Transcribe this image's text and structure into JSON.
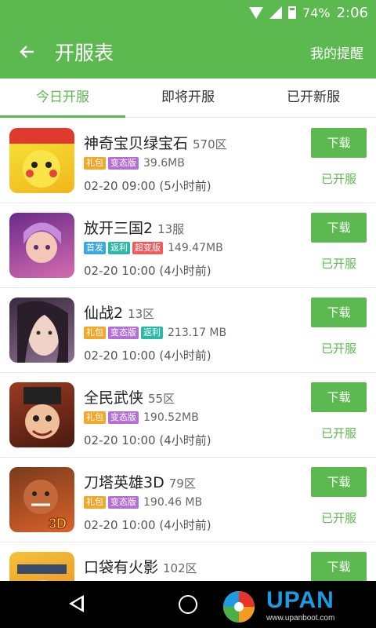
{
  "status_bar": {
    "battery": "74%",
    "time": "2:06"
  },
  "header": {
    "title": "开服表",
    "right_action": "我的提醒"
  },
  "tabs": [
    {
      "label": "今日开服",
      "active": true
    },
    {
      "label": "即将开服",
      "active": false
    },
    {
      "label": "已开新服",
      "active": false
    }
  ],
  "tag_colors": {
    "礼包": "#f3a82c",
    "变态版": "#b36fd6",
    "返利": "#2fb6a6",
    "首发": "#3aa8e0",
    "超变版": "#ef5a5a"
  },
  "games": [
    {
      "name": "神奇宝贝绿宝石",
      "server": "570区",
      "tags": [
        "礼包",
        "变态版"
      ],
      "size": "39.6MB",
      "time": "02-20 09:00 (5小时前)",
      "download": "下载",
      "status": "已开服",
      "icon": "pikachu-game-icon"
    },
    {
      "name": "放开三国2",
      "server": "13服",
      "tags": [
        "首发",
        "返利",
        "超变版"
      ],
      "size": "149.47MB",
      "time": "02-20 10:00 (4小时前)",
      "download": "下载",
      "status": "已开服",
      "icon": "three-kingdoms-game-icon"
    },
    {
      "name": "仙战2",
      "server": "13区",
      "tags": [
        "礼包",
        "变态版",
        "返利"
      ],
      "size": "213.17 MB",
      "time": "02-20 10:00 (4小时前)",
      "download": "下载",
      "status": "已开服",
      "icon": "xianzhan-game-icon"
    },
    {
      "name": "全民武侠",
      "server": "55区",
      "tags": [
        "礼包",
        "变态版"
      ],
      "size": "190.52MB",
      "time": "02-20 10:00 (4小时前)",
      "download": "下载",
      "status": "已开服",
      "icon": "wuxia-game-icon"
    },
    {
      "name": "刀塔英雄3D",
      "server": "79区",
      "tags": [
        "礼包",
        "变态版"
      ],
      "size": "190.46 MB",
      "time": "02-20 10:00 (4小时前)",
      "download": "下载",
      "status": "已开服",
      "icon": "dota-hero-game-icon"
    },
    {
      "name": "口袋有火影",
      "server": "102区",
      "tags": [],
      "size": "",
      "time": "",
      "download": "下载",
      "status": "",
      "icon": "naruto-game-icon"
    }
  ],
  "watermark": {
    "brand": "UPAN",
    "url": "www.upanboot.com"
  }
}
